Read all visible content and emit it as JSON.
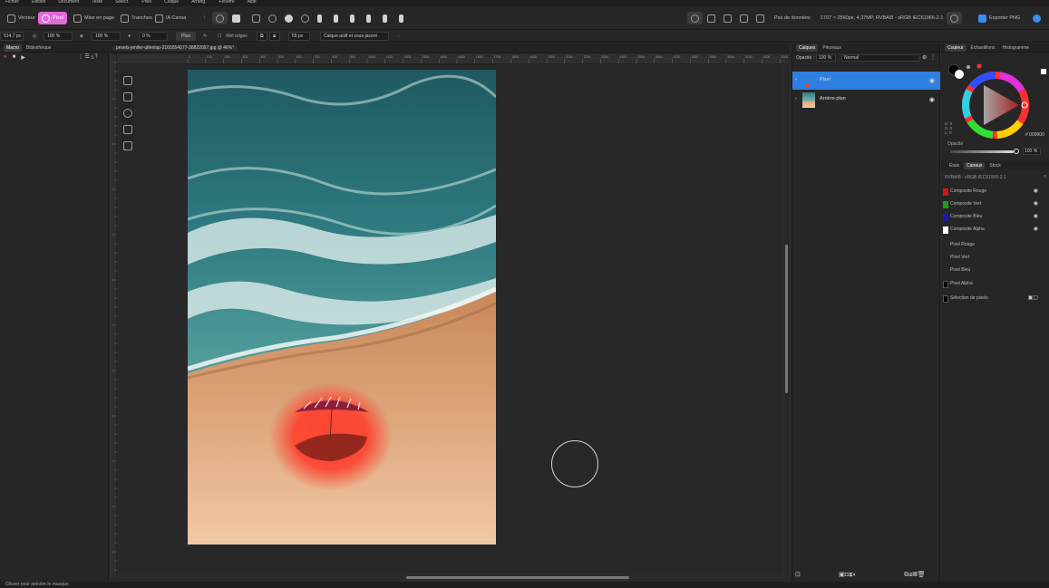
{
  "menu": [
    "Fichier",
    "Édition",
    "Document",
    "Texte",
    "Sélect.",
    "Pixel",
    "Calque",
    "Arrang.",
    "Fenêtre",
    "Aide"
  ],
  "toolbar": {
    "personas": [
      {
        "label": "Vecteur",
        "icon": "vector-persona-icon"
      },
      {
        "label": "Pixel",
        "icon": "pixel-persona-icon"
      },
      {
        "label": "Mise en page",
        "icon": "layout-persona-icon"
      },
      {
        "label": "Tranches",
        "icon": "slices-persona-icon"
      },
      {
        "label": "IA Canva",
        "icon": "ai-canva-icon"
      }
    ],
    "no_data": "Pas de données",
    "doc_info": "1707 × 2560px, 4,37MP, RVBA/8 - sRGB IEC61966-2.1",
    "export_label": "Exporter PNG"
  },
  "context": {
    "width": "514,7 px",
    "opacity": "100 %",
    "flow": "100 %",
    "hardness": "0 %",
    "more": "Plus",
    "wet_edges": "Wet edges",
    "size": "55 px",
    "source": "Calque actif et sous-jacent"
  },
  "left_panel": {
    "tabs": [
      "Macro",
      "Bibliothèque"
    ]
  },
  "document": {
    "tab": "pexels-jenifer-ulfenlap-2165554077-38822057.jpg @ 46%*"
  },
  "ruler": {
    "ticks": [
      "0",
      "100",
      "200",
      "300",
      "400",
      "500",
      "600",
      "700",
      "800",
      "900",
      "1000",
      "1100",
      "1200",
      "1300",
      "1400",
      "1500",
      "1600",
      "1700",
      "1800",
      "1900",
      "2000",
      "2100",
      "2200",
      "2300",
      "2400",
      "2500",
      "2600",
      "2700",
      "2800",
      "2900",
      "3000",
      "3100",
      "3200",
      "3300"
    ]
  },
  "layers": {
    "tabs": [
      "Calques",
      "Pinceaux"
    ],
    "opacity_label": "Opacité :",
    "opacity": "100 %",
    "blend": "Normal",
    "items": [
      {
        "name": "Pixel",
        "selected": true
      },
      {
        "name": "Arrière-plan",
        "selected": false
      }
    ]
  },
  "color": {
    "tabs": [
      "Couleur",
      "Échantillons",
      "Histogramme"
    ],
    "hex": "# 000000",
    "opacity_label": "Opacité",
    "opacity": "100 %",
    "hsl": [
      "H: 0",
      "S: 0",
      "L: 0"
    ]
  },
  "channels": {
    "tabs": [
      "Étuis",
      "Canaux",
      "Stock"
    ],
    "profile": "RVBA/8 - sRGB IEC61966-2.1",
    "composites": [
      {
        "label": "Composite Rouge",
        "color": "#d01616"
      },
      {
        "label": "Composite Vert",
        "color": "#16a016"
      },
      {
        "label": "Composite Bleu",
        "color": "#1a1ab0"
      },
      {
        "label": "Composite Alpha",
        "color": "#ffffff"
      }
    ],
    "pixel": [
      {
        "label": "Pixel Rouge",
        "color": ""
      },
      {
        "label": "Pixel Vert",
        "color": ""
      },
      {
        "label": "Pixel Bleu",
        "color": ""
      },
      {
        "label": "Pixel Alpha",
        "color": "#000000"
      },
      {
        "label": "Sélection de pixels",
        "color": "#000000"
      }
    ]
  },
  "status": "Glisser pour peindre le masque."
}
